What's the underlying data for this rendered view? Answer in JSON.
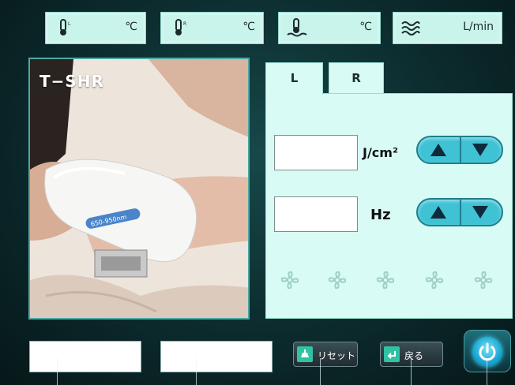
{
  "sensors": [
    {
      "icon": "thermometer-icon",
      "unit": "℃"
    },
    {
      "icon": "thermometer-icon",
      "unit": "℃"
    },
    {
      "icon": "water-temperature-icon",
      "unit": "℃"
    },
    {
      "icon": "water-flow-icon",
      "unit": "L/min"
    }
  ],
  "handpiece": {
    "title": "T−SHR",
    "wavelength_label": "650-950nm"
  },
  "tabs": [
    {
      "label": "L",
      "active": true
    },
    {
      "label": "R",
      "active": false
    }
  ],
  "energy": {
    "value": "",
    "unit": "J/cm²"
  },
  "frequency": {
    "value": "",
    "unit": "Hz"
  },
  "fans": [
    "fan-icon",
    "fan-icon",
    "fan-icon",
    "fan-icon",
    "fan-icon"
  ],
  "bottom": {
    "field1_value": "",
    "field2_value": "",
    "reset_label": "リセット",
    "back_label": "戻る"
  },
  "colors": {
    "panel": "#d8fbf5",
    "stepper": "#3ec2d4",
    "accent": "#31c2a4"
  }
}
